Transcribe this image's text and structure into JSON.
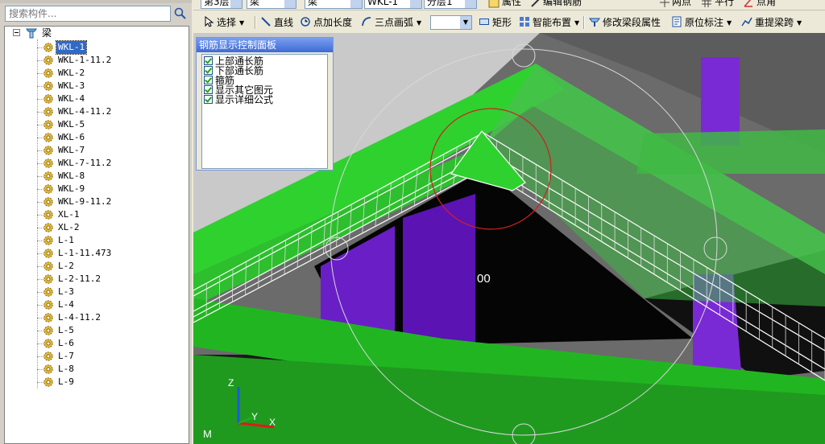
{
  "toolbar_top": {
    "floor": "第3层",
    "type1": "梁",
    "type2": "梁",
    "element": "WKL-1",
    "layer": "分层1",
    "property_label": "属性",
    "edit_rebar_label": "编辑钢筋",
    "two_point_label": "两点",
    "parallel_label": "平行",
    "point_angle_label": "点角"
  },
  "toolbar": {
    "select_label": "选择",
    "line_label": "直线",
    "point_length_label": "点加长度",
    "three_point_arc_label": "三点画弧",
    "rect_label": "矩形",
    "smart_layout_label": "智能布置",
    "modify_span_label": "修改梁段属性",
    "original_mark_label": "原位标注",
    "re_extract_label": "重提梁跨"
  },
  "search": {
    "placeholder": "搜索构件..."
  },
  "tree": {
    "root_label": "梁",
    "items": [
      {
        "label": "WKL-1",
        "selected": true
      },
      {
        "label": "WKL-1-11.2"
      },
      {
        "label": "WKL-2"
      },
      {
        "label": "WKL-3"
      },
      {
        "label": "WKL-4"
      },
      {
        "label": "WKL-4-11.2"
      },
      {
        "label": "WKL-5"
      },
      {
        "label": "WKL-6"
      },
      {
        "label": "WKL-7"
      },
      {
        "label": "WKL-7-11.2"
      },
      {
        "label": "WKL-8"
      },
      {
        "label": "WKL-9"
      },
      {
        "label": "WKL-9-11.2"
      },
      {
        "label": "XL-1"
      },
      {
        "label": "XL-2"
      },
      {
        "label": "L-1"
      },
      {
        "label": "L-1-11.473"
      },
      {
        "label": "L-2"
      },
      {
        "label": "L-2-11.2"
      },
      {
        "label": "L-3"
      },
      {
        "label": "L-4"
      },
      {
        "label": "L-4-11.2"
      },
      {
        "label": "L-5"
      },
      {
        "label": "L-6"
      },
      {
        "label": "L-7"
      },
      {
        "label": "L-8"
      },
      {
        "label": "L-9"
      }
    ]
  },
  "panel": {
    "title": "钢筋显示控制面板",
    "options": [
      {
        "label": "上部通长筋",
        "checked": true
      },
      {
        "label": "下部通长筋",
        "checked": true
      },
      {
        "label": "箍筋",
        "checked": true
      },
      {
        "label": "显示其它图元",
        "checked": true
      },
      {
        "label": "显示详细公式",
        "checked": true
      }
    ]
  },
  "viewport": {
    "dimension_text": "00",
    "axis_x": "X",
    "axis_y": "Y",
    "axis_z": "Z",
    "corner_text": "M"
  },
  "colors": {
    "beam_green": "#39c93a",
    "column_purple": "#6a1fc6",
    "highlight_circle": "#d21f1f",
    "selection_blue": "#316ac5"
  }
}
